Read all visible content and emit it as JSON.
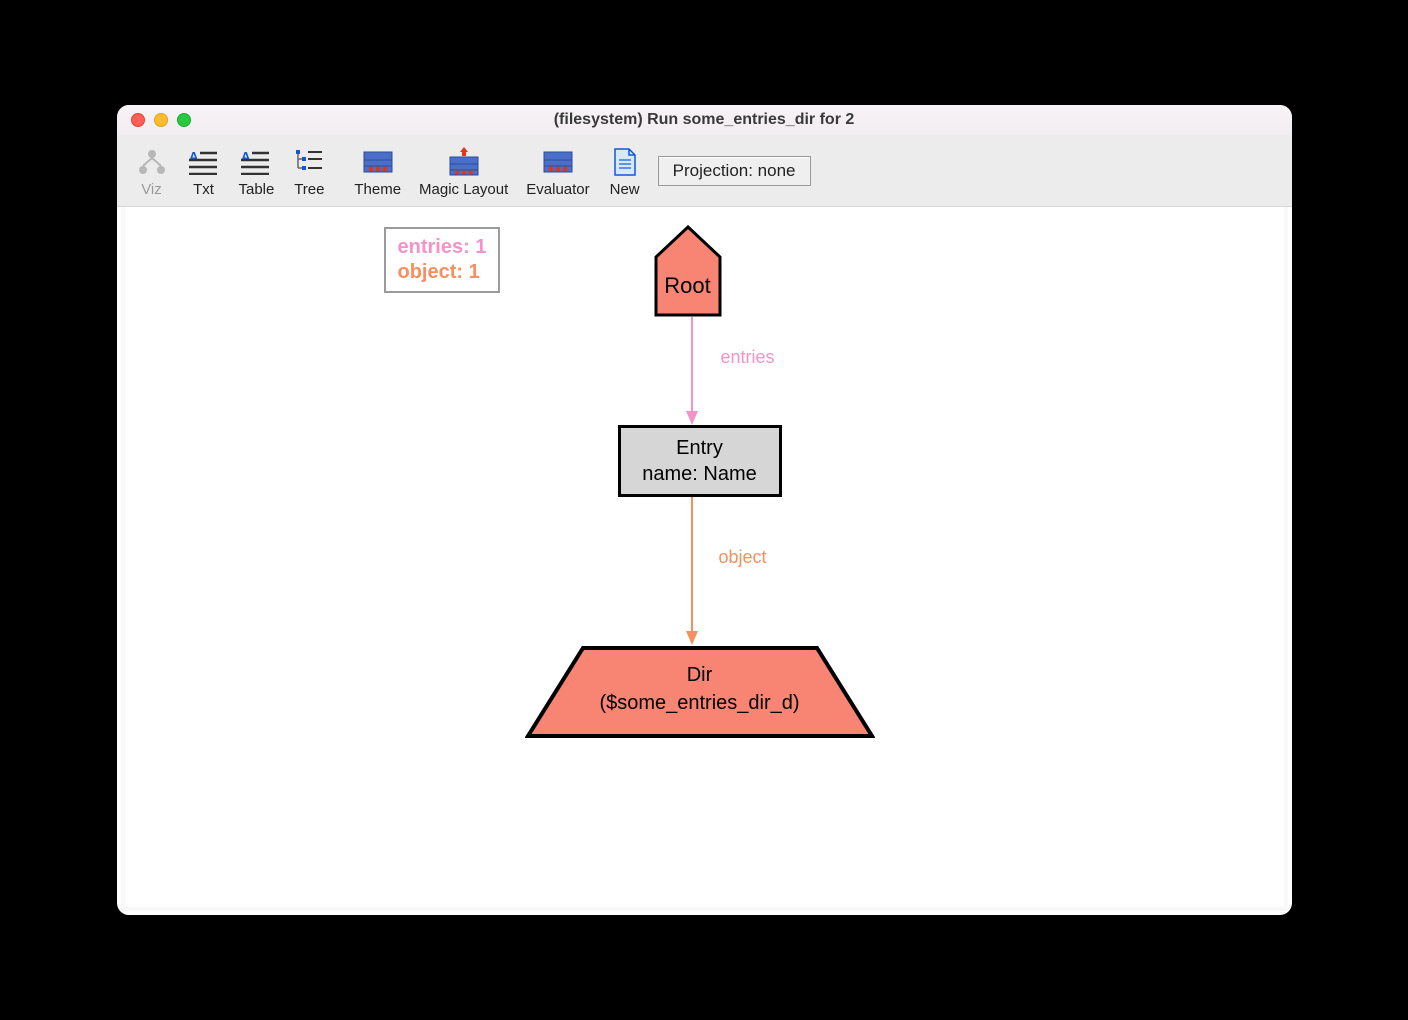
{
  "window": {
    "title": "(filesystem) Run some_entries_dir for 2"
  },
  "toolbar": {
    "viz": "Viz",
    "txt": "Txt",
    "table": "Table",
    "tree": "Tree",
    "theme": "Theme",
    "magic_layout": "Magic Layout",
    "evaluator": "Evaluator",
    "new": "New",
    "projection": "Projection: none"
  },
  "legend": {
    "entries": "entries: 1",
    "object": "object: 1"
  },
  "diagram": {
    "root": "Root",
    "entry_line1": "Entry",
    "entry_line2": "name: Name",
    "dir_line1": "Dir",
    "dir_line2": "($some_entries_dir_d)",
    "edge_entries": "entries",
    "edge_object": "object"
  },
  "colors": {
    "salmon": "#f88573",
    "gray_node": "#d6d6d6",
    "entries_edge": "#f593c9",
    "object_edge": "#f78f5f"
  }
}
